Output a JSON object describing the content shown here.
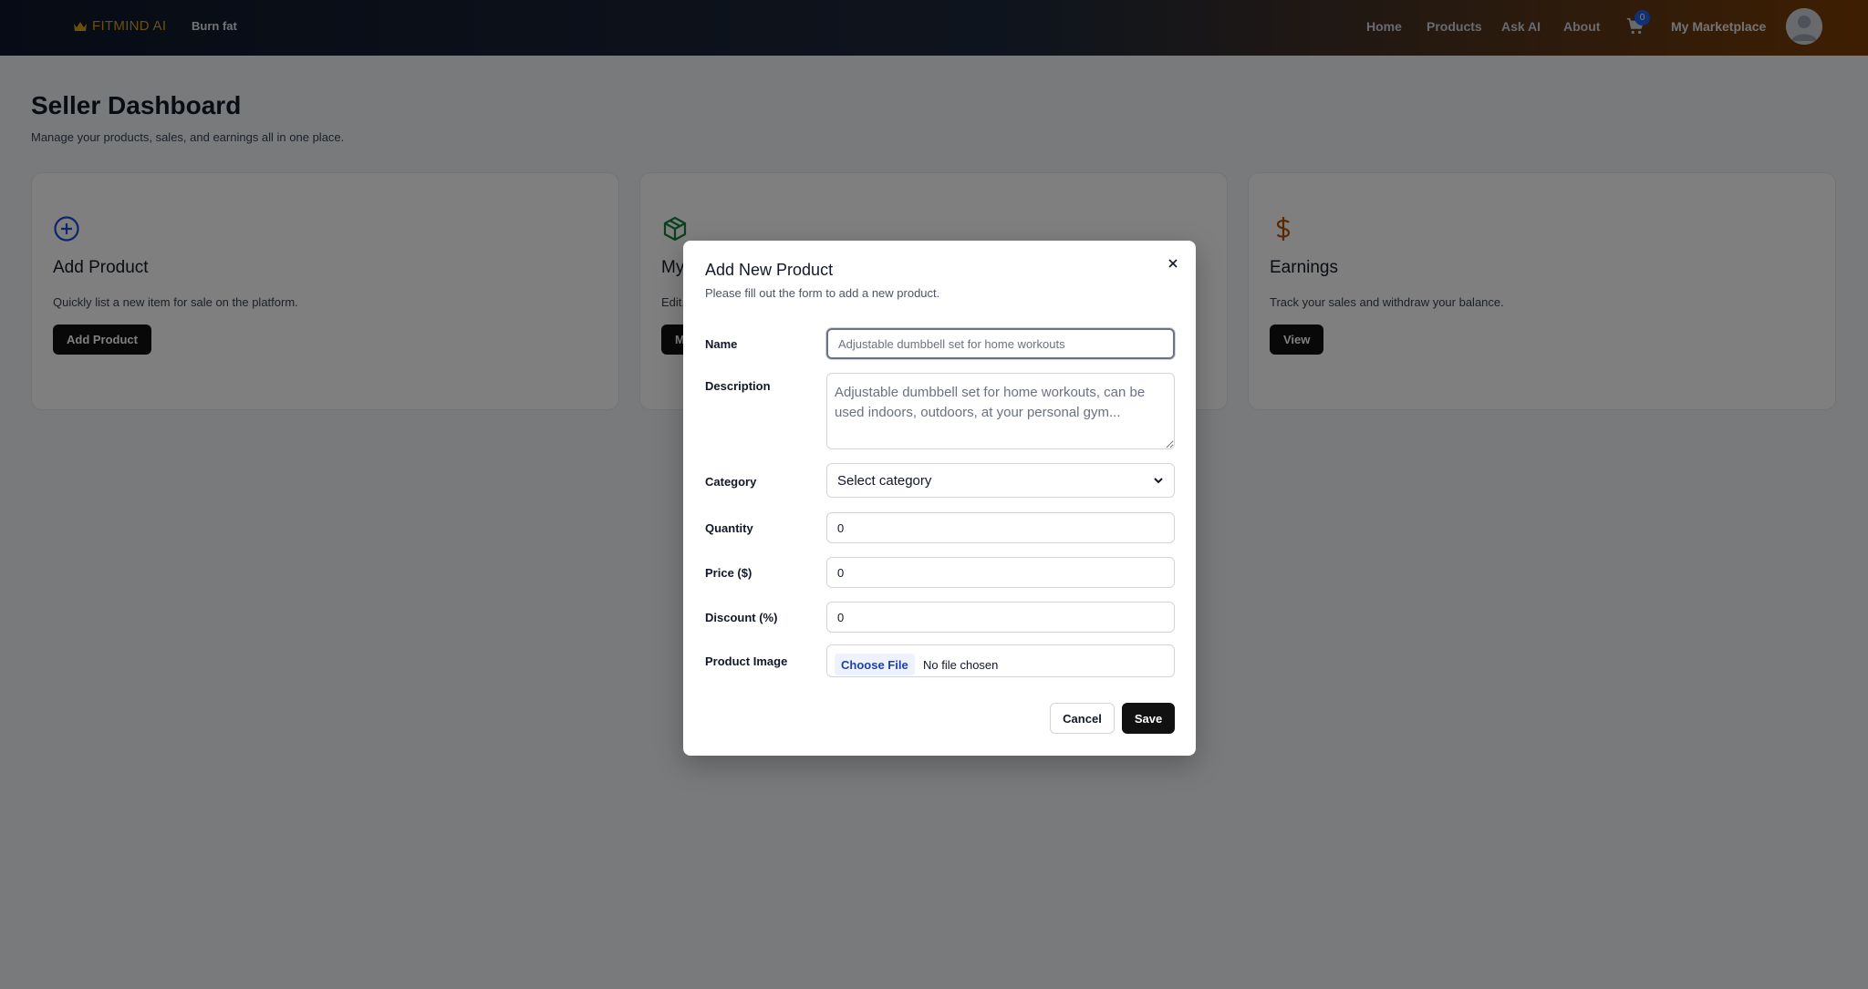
{
  "navbar": {
    "brand": "FITMIND AI",
    "tagline": "Burn fat",
    "links": [
      "Home",
      "Products",
      "Ask AI",
      "About"
    ],
    "cart_count": "0",
    "marketplace": "My Marketplace",
    "icons": {
      "brand": "crown-icon",
      "cart": "cart-icon",
      "avatar": "user-avatar-icon"
    }
  },
  "dashboard": {
    "title": "Seller Dashboard",
    "subtitle": "Manage your products, sales, and earnings all in one place.",
    "cards": [
      {
        "title": "Add Product",
        "description": "Quickly list a new item for sale on the platform.",
        "button": "Add Product",
        "icon": "plus-circle-icon",
        "color": "#1d4ed8"
      },
      {
        "title": "My",
        "description": "Edit,",
        "button": "M",
        "icon": "box-icon",
        "color": "#15803d"
      },
      {
        "title": "Earnings",
        "description": "Track your sales and withdraw your balance.",
        "button": "View",
        "icon": "dollar-icon",
        "color": "#b45309"
      }
    ]
  },
  "modal": {
    "title": "Add New Product",
    "subtitle": "Please fill out the form to add a new product.",
    "fields": {
      "name": {
        "label": "Name",
        "placeholder": "Adjustable dumbbell set for home workouts"
      },
      "description": {
        "label": "Description",
        "placeholder": "Adjustable dumbbell set for home workouts, can be used indoors, outdoors, at your personal gym..."
      },
      "category": {
        "label": "Category",
        "value": "Select category"
      },
      "quantity": {
        "label": "Quantity",
        "value": "0"
      },
      "price": {
        "label": "Price ($)",
        "value": "0"
      },
      "discount": {
        "label": "Discount (%)",
        "value": "0"
      },
      "image": {
        "label": "Product Image",
        "button": "Choose File",
        "status": "No file chosen"
      }
    },
    "cancel": "Cancel",
    "save": "Save"
  }
}
